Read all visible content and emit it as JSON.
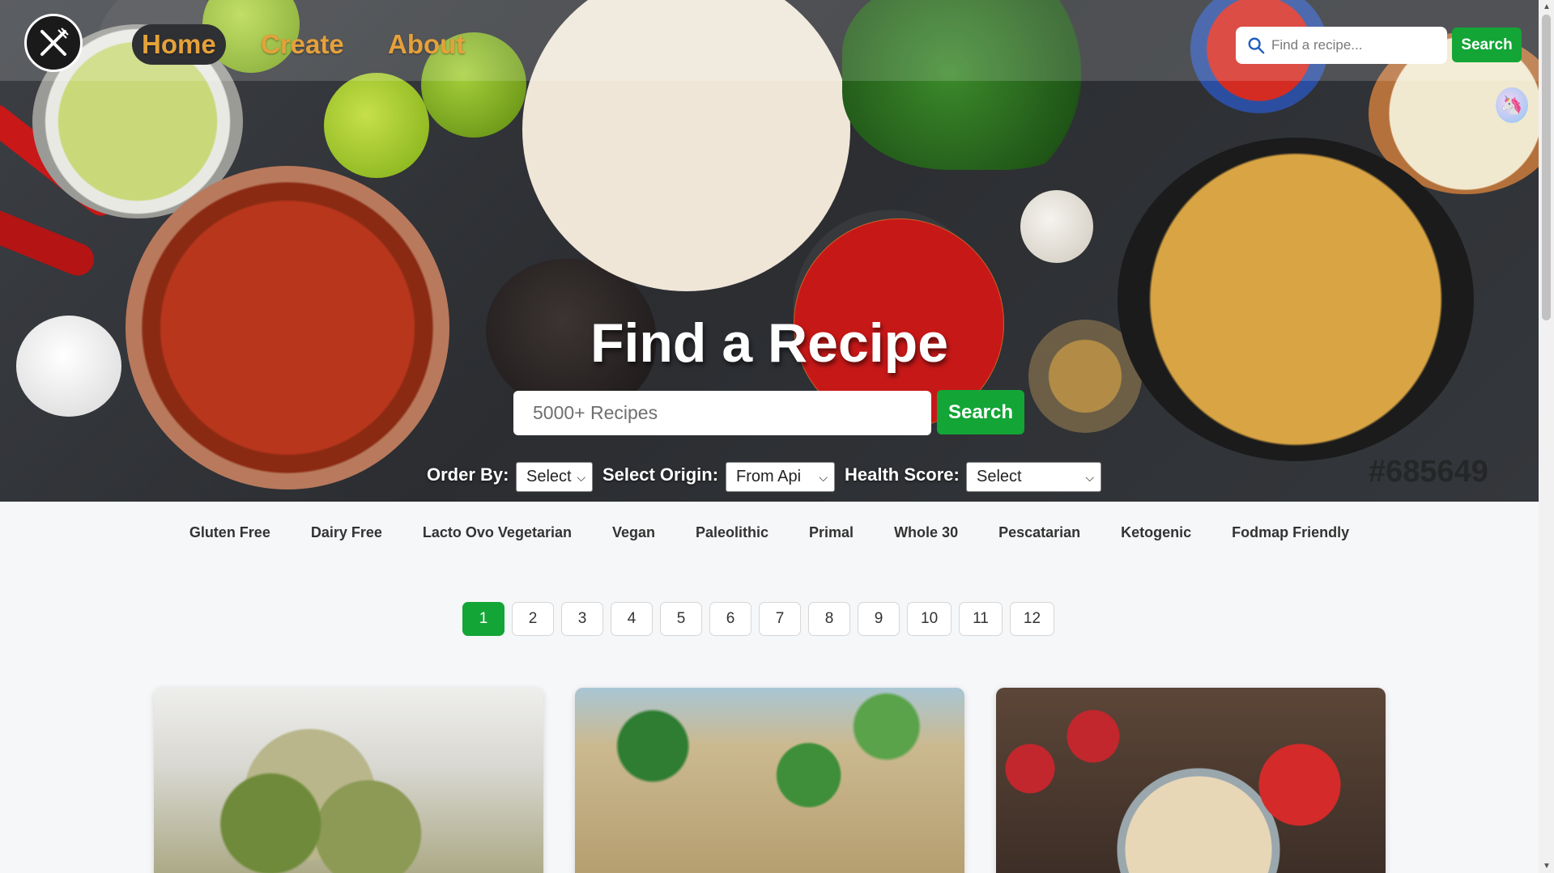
{
  "nav": {
    "links": [
      {
        "label": "Home",
        "active": true
      },
      {
        "label": "Create",
        "active": false
      },
      {
        "label": "About",
        "active": false
      }
    ],
    "search_placeholder": "Find a recipe...",
    "search_button": "Search"
  },
  "hero": {
    "title": "Find a Recipe",
    "search_placeholder": "5000+ Recipes",
    "search_button": "Search",
    "watermark": "#685649"
  },
  "filters": {
    "order_label": "Order By:",
    "order_value": "Select",
    "origin_label": "Select Origin:",
    "origin_value": "From Api",
    "health_label": "Health Score:",
    "health_value": "Select"
  },
  "diets": [
    "Gluten Free",
    "Dairy Free",
    "Lacto Ovo Vegetarian",
    "Vegan",
    "Paleolithic",
    "Primal",
    "Whole 30",
    "Pescatarian",
    "Ketogenic",
    "Fodmap Friendly"
  ],
  "pagination": {
    "pages": [
      "1",
      "2",
      "3",
      "4",
      "5",
      "6",
      "7",
      "8",
      "9",
      "10",
      "11",
      "12"
    ],
    "active": "1"
  },
  "colors": {
    "accent_green": "#13a536",
    "nav_link": "#e5a13a"
  },
  "icons": {
    "logo": "fork-knife-icon",
    "search": "search-icon",
    "avatar": "unicorn-icon"
  }
}
